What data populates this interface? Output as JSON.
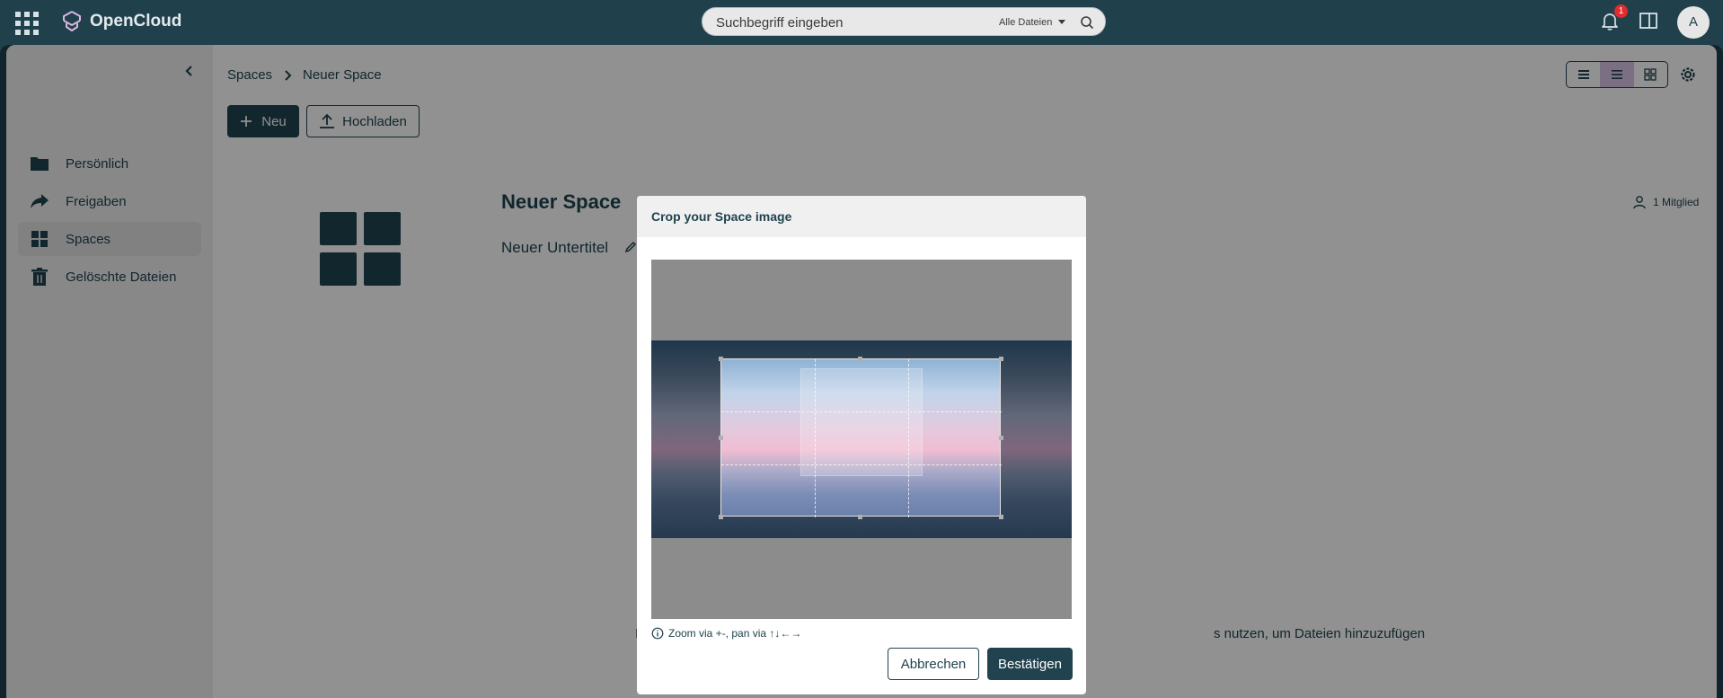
{
  "topbar": {
    "app_name": "OpenCloud",
    "search_placeholder": "Suchbegriff eingeben",
    "search_scope": "Alle Dateien",
    "notification_count": "1",
    "avatar_initial": "A"
  },
  "sidebar": {
    "items": [
      {
        "label": "Persönlich",
        "icon": "folder-icon",
        "active": false
      },
      {
        "label": "Freigaben",
        "icon": "share-arrow-icon",
        "active": false
      },
      {
        "label": "Spaces",
        "icon": "grid-icon",
        "active": true
      },
      {
        "label": "Gelöschte Dateien",
        "icon": "trash-icon",
        "active": false
      }
    ]
  },
  "breadcrumb": {
    "root": "Spaces",
    "current": "Neuer Space"
  },
  "toolbar": {
    "new_label": "Neu",
    "upload_label": "Hochladen"
  },
  "space": {
    "title": "Neuer Space",
    "subtitle": "Neuer Untertitel",
    "members": "1 Mitglied"
  },
  "empty_state": {
    "hint_prefix": "I",
    "hint_suffix": "s nutzen, um Dateien hinzuzufügen"
  },
  "modal": {
    "title": "Crop your Space image",
    "zoom_hint": "Zoom via +-, pan via ↑↓←→",
    "cancel_label": "Abbrechen",
    "confirm_label": "Bestätigen"
  },
  "colors": {
    "brand_dark": "#20434f",
    "badge_red": "#e02c2c",
    "view_active": "#d8c5e6"
  }
}
